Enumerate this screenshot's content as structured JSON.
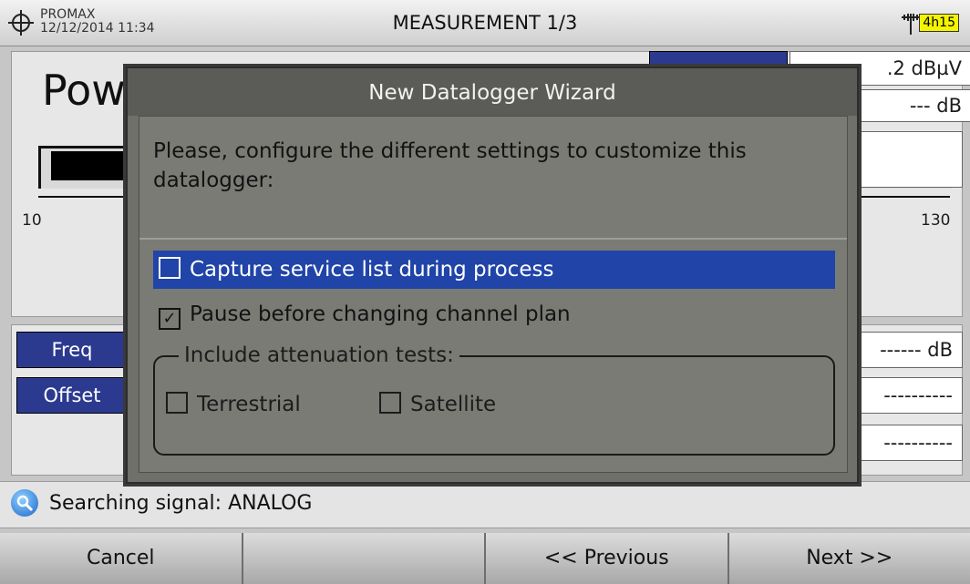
{
  "header": {
    "brand": "PROMAX",
    "datetime": "12/12/2014 11:34",
    "title": "MEASUREMENT 1/3",
    "battery": "4h15",
    "target_icon": "crosshair-icon",
    "antenna_icon": "antenna-icon"
  },
  "background": {
    "measurement_title": "Pow",
    "level_value": ".2 dBµV",
    "cn_value": "--- dB",
    "scale_min": "10",
    "scale_max": "130",
    "freq_label": "Freq",
    "offset_label": "Offset",
    "freq_value": "------ dB",
    "offset_value": "----------",
    "extra_value": "----------"
  },
  "dialog": {
    "title": "New Datalogger Wizard",
    "message": "Please, configure the different settings to customize this datalogger:",
    "options": [
      {
        "label": "Capture service list during process",
        "checked": false,
        "selected": true
      },
      {
        "label": "Pause before changing channel plan",
        "checked": true,
        "selected": false
      }
    ],
    "attenuation": {
      "legend": "Include attenuation tests:",
      "terrestrial": "Terrestrial",
      "satellite": "Satellite"
    }
  },
  "status": {
    "icon": "search-icon",
    "text": "Searching signal: ANALOG"
  },
  "softkeys": [
    "Cancel",
    "",
    "<< Previous",
    "Next >>"
  ],
  "colors": {
    "selection": "#2044a8",
    "battery": "#f4f400",
    "label_blue": "#2b3a8f"
  }
}
